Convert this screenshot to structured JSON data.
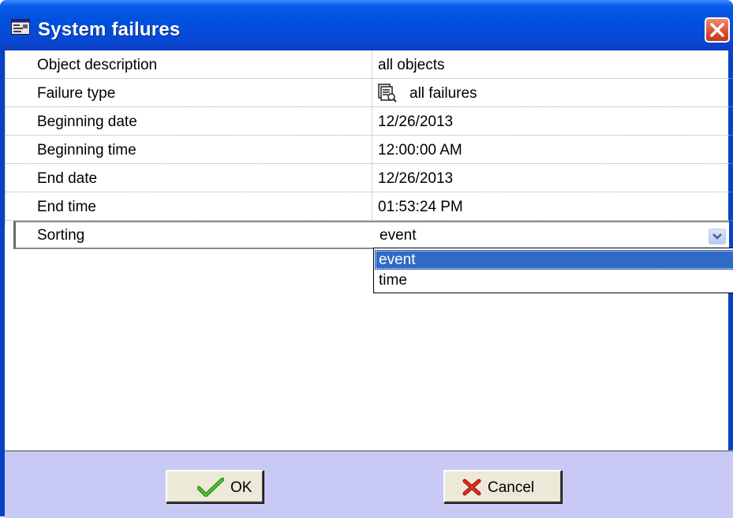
{
  "window": {
    "title": "System failures",
    "icon": "window-app-icon",
    "close_icon": "close-icon"
  },
  "properties": [
    {
      "label": "Object description",
      "value": "all objects"
    },
    {
      "label": "Failure type",
      "value": "all failures",
      "icon": "failures-list-icon"
    },
    {
      "label": "Beginning date",
      "value": "12/26/2013"
    },
    {
      "label": "Beginning time",
      "value": "12:00:00 AM"
    },
    {
      "label": "End date",
      "value": "12/26/2013"
    },
    {
      "label": "End time",
      "value": "01:53:24 PM"
    }
  ],
  "sorting": {
    "label": "Sorting",
    "value": "event",
    "options": [
      "event",
      "time"
    ],
    "selected_option": "event"
  },
  "buttons": {
    "ok_label": "OK",
    "cancel_label": "Cancel"
  },
  "colors": {
    "titlebar": "#0050e0",
    "selection": "#316ac5",
    "button_bar": "#c8c9f4"
  }
}
